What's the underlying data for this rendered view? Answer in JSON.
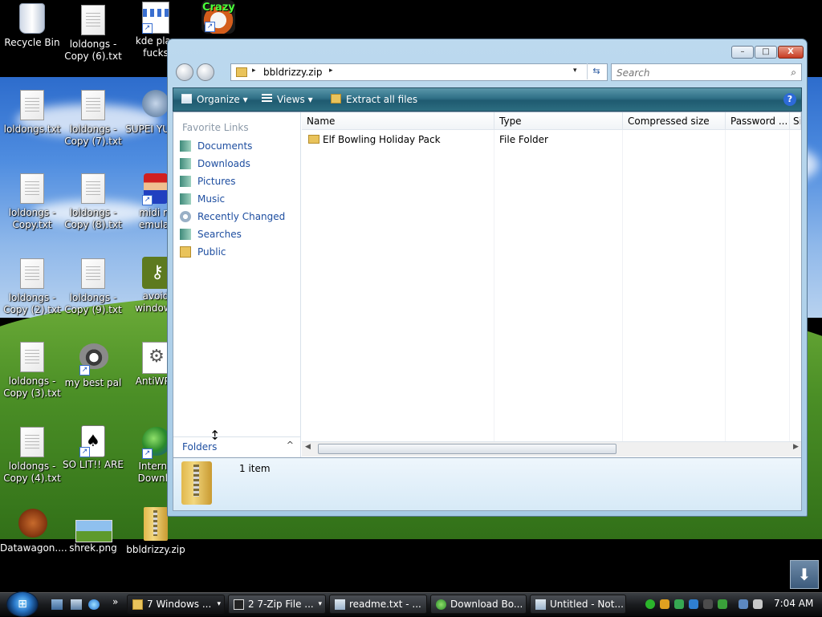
{
  "desktop_icons": [
    {
      "label": "Recycle Bin"
    },
    {
      "label": "loldongs - Copy (6).txt"
    },
    {
      "label": "kde plas fucks"
    },
    {
      "label": "Crazy"
    },
    {
      "label": "loldongs.txt"
    },
    {
      "label": "loldongs - Copy (7).txt"
    },
    {
      "label": "SUPEI YUMM"
    },
    {
      "label": "loldongs - Copy.txt"
    },
    {
      "label": "loldongs - Copy (8).txt"
    },
    {
      "label": "midi m emulat"
    },
    {
      "label": "loldongs - Copy (2).txt"
    },
    {
      "label": "loldongs - Copy (9).txt"
    },
    {
      "label": "avoid windows"
    },
    {
      "label": "loldongs - Copy (3).txt"
    },
    {
      "label": "my best pal"
    },
    {
      "label": "AntiWPA"
    },
    {
      "label": "loldongs - Copy (4).txt"
    },
    {
      "label": "SO LIT!! ARE"
    },
    {
      "label": "Interne Downlo"
    },
    {
      "label": "Datawagon...."
    },
    {
      "label": "shrek.png"
    },
    {
      "label": "bbldrizzy.zip"
    }
  ],
  "window": {
    "buttons": {
      "minimize": "–",
      "maximize": "□",
      "close": "X"
    },
    "address": {
      "path": "bbldrizzy.zip",
      "sep": "▸",
      "drop": "▾",
      "refresh": "⇆"
    },
    "search": {
      "placeholder": "Search",
      "icon": "⌕"
    },
    "toolbar": {
      "organize": "Organize",
      "views": "Views",
      "extract": "Extract all files",
      "help": "?",
      "drop": "▾"
    },
    "nav": {
      "heading": "Favorite Links",
      "items": [
        {
          "label": "Documents"
        },
        {
          "label": "Downloads"
        },
        {
          "label": "Pictures"
        },
        {
          "label": "Music"
        },
        {
          "label": "Recently Changed"
        },
        {
          "label": "Searches"
        },
        {
          "label": "Public"
        }
      ],
      "folders_label": "Folders",
      "folders_chevron": "^"
    },
    "columns": {
      "name": "Name",
      "type": "Type",
      "compressed": "Compressed size",
      "password": "Password ...",
      "size": "Si"
    },
    "rows": [
      {
        "name": "Elf Bowling Holiday Pack",
        "type": "File Folder"
      }
    ],
    "status": {
      "count": "1 item"
    }
  },
  "taskbar": {
    "start": "⊞",
    "tasks": [
      {
        "label": "7 Windows ...",
        "active": true
      },
      {
        "label": "2 7-Zip File ..."
      },
      {
        "label": "readme.txt - ..."
      },
      {
        "label": "Download Bo..."
      },
      {
        "label": "Untitled - Not..."
      }
    ],
    "clock": "7:04 AM",
    "drop": "▾",
    "overflow": "»"
  },
  "colors": {
    "accent": "#1e4ea0",
    "folder": "#e9c35b",
    "toolbar": "#2f6f86"
  }
}
